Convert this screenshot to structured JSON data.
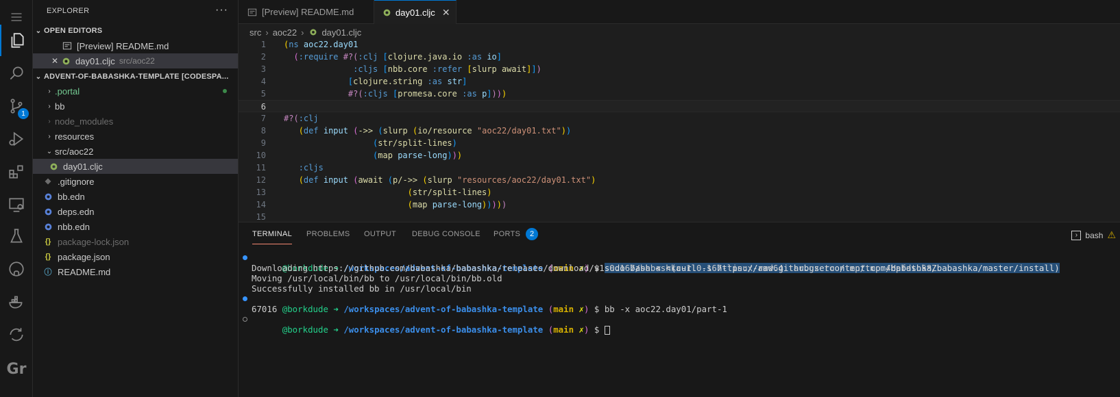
{
  "sidebar": {
    "title": "EXPLORER",
    "more": "···",
    "open_editors_label": "OPEN EDITORS",
    "open_editors": [
      {
        "name": "[Preview] README.md",
        "desc": ""
      },
      {
        "name": "day01.cljc",
        "desc": "src/aoc22",
        "close": "✕"
      }
    ],
    "workspace_label": "ADVENT-OF-BABASHKA-TEMPLATE [CODESPA...",
    "tree": [
      {
        "name": ".portal"
      },
      {
        "name": "bb"
      },
      {
        "name": "node_modules"
      },
      {
        "name": "resources"
      },
      {
        "name": "src/aoc22"
      },
      {
        "name": "day01.cljc"
      },
      {
        "name": ".gitignore"
      },
      {
        "name": "bb.edn"
      },
      {
        "name": "deps.edn"
      },
      {
        "name": "nbb.edn"
      },
      {
        "name": "package-lock.json"
      },
      {
        "name": "package.json"
      },
      {
        "name": "README.md"
      }
    ],
    "json_icon": "{}",
    "info_icon": "ⓘ"
  },
  "activity": {
    "scm_badge": "1",
    "gr_label": "Gr"
  },
  "tabs": [
    {
      "label": "[Preview] README.md"
    },
    {
      "label": "day01.cljc",
      "close": "✕"
    }
  ],
  "breadcrumb": [
    "src",
    "aoc22",
    "day01.cljc"
  ],
  "editor": {
    "line_numbers": [
      "1",
      "2",
      "3",
      "4",
      "5",
      "6",
      "7",
      "8",
      "9",
      "10",
      "11",
      "12",
      "13",
      "14",
      "15"
    ]
  },
  "panel": {
    "tabs": [
      "TERMINAL",
      "PROBLEMS",
      "OUTPUT",
      "DEBUG CONSOLE",
      "PORTS"
    ],
    "ports_badge": "2",
    "shell": "bash",
    "terminal": {
      "user": "@borkdude",
      "arrow": "➜",
      "path": "/workspaces/advent-of-babashka-template",
      "branch_open": "(",
      "branch": "main",
      "dirty": "✗",
      "branch_close": ")",
      "prompt": "$",
      "cmd1": "sudo bash < <(curl -s https://raw.githubusercontent.com/babashka/babashka/master/install)",
      "out1": "Downloading https://github.com/babashka/babashka/releases/download/v1.0.167/babashka-1.0.167-linux-amd64.tar.gz to /tmp/tmp.4Hpfdto58Z",
      "out2": "Moving /usr/local/bin/bb to /usr/local/bin/bb.old",
      "out3": "Successfully installed bb in /usr/local/bin",
      "cmd2": "bb -x aoc22.day01/part-1",
      "out4": "67016"
    }
  },
  "colors": {
    "accent": "#0078d4",
    "background": "#1e1e1e",
    "sidebar": "#181818"
  }
}
